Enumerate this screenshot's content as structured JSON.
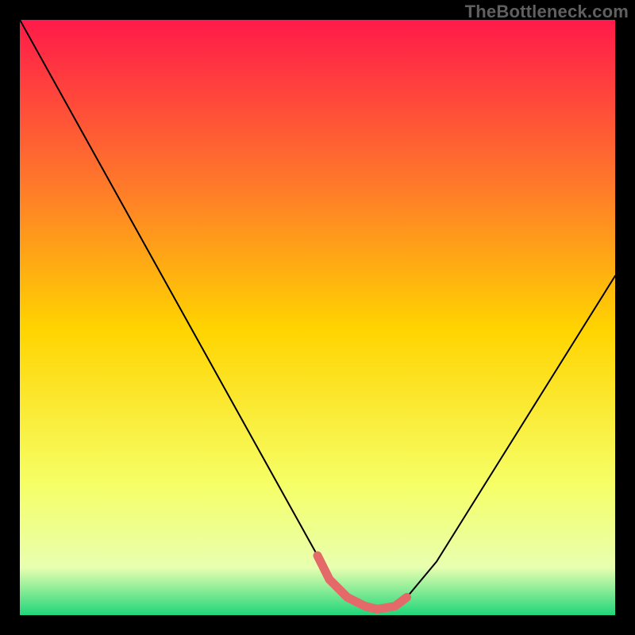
{
  "watermark": "TheBottleneck.com",
  "colors": {
    "background": "#000000",
    "curve": "#000000",
    "highlight": "#e46a6a",
    "gradient_top": "#ff1a4a",
    "gradient_mid_top": "#ff7a2a",
    "gradient_mid": "#ffd400",
    "gradient_mid_bot": "#f6ff66",
    "gradient_bot_high": "#e8ffb0",
    "gradient_bot": "#1fd67a"
  },
  "chart_data": {
    "type": "line",
    "title": "",
    "xlabel": "",
    "ylabel": "",
    "xlim": [
      0,
      100
    ],
    "ylim": [
      0,
      100
    ],
    "series": [
      {
        "name": "bottleneck-curve",
        "x": [
          0,
          5,
          10,
          15,
          20,
          25,
          30,
          35,
          40,
          45,
          50,
          52,
          55,
          58,
          60,
          63,
          65,
          70,
          75,
          80,
          85,
          90,
          95,
          100
        ],
        "y": [
          100,
          91,
          82,
          73,
          64,
          55,
          46,
          37,
          28,
          19,
          10,
          6,
          3,
          1.5,
          1,
          1.5,
          3,
          9,
          17,
          25,
          33,
          41,
          49,
          57
        ]
      }
    ],
    "highlight": {
      "name": "optimal-range",
      "x": [
        50,
        52,
        55,
        58,
        60,
        63,
        65
      ],
      "y": [
        10,
        6,
        3,
        1.5,
        1,
        1.5,
        3
      ]
    }
  }
}
